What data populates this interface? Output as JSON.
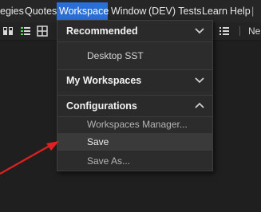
{
  "menubar": {
    "items": [
      {
        "label": "egies"
      },
      {
        "label": "Quotes"
      },
      {
        "label": "Workspace"
      },
      {
        "label": "Window"
      },
      {
        "label": "(DEV) Tests"
      },
      {
        "label": "Learn"
      },
      {
        "label": "Help"
      }
    ],
    "active_color": "#2a6fd6"
  },
  "toolbar": {
    "new_label": "Ne"
  },
  "workspace_menu": {
    "sections": [
      {
        "title": "Recommended",
        "chevron": "chevron-down-icon",
        "items": [
          "Desktop SST"
        ]
      },
      {
        "title": "My Workspaces",
        "chevron": "chevron-down-icon",
        "items": []
      },
      {
        "title": "Configurations",
        "chevron": "chevron-up-icon",
        "items": [
          "Workspaces Manager...",
          "Save",
          "Save As..."
        ]
      }
    ],
    "hovered_item": "Save"
  },
  "annotation": {
    "icon": "red-arrow-icon",
    "color": "#e02020"
  }
}
